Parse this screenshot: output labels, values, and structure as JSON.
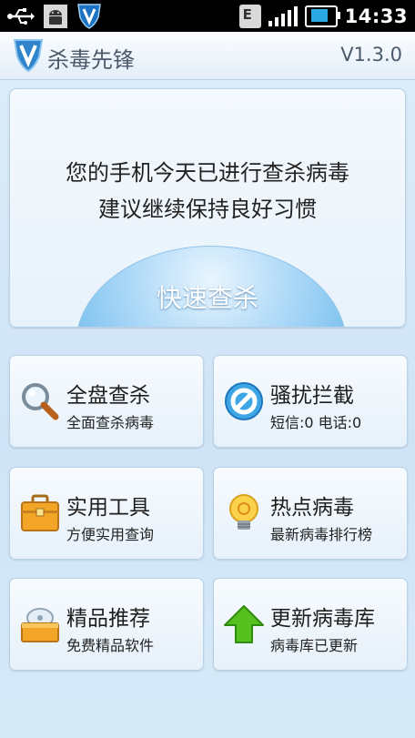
{
  "status_bar": {
    "time": "14:33",
    "network_type": "E",
    "icons": [
      "usb-icon",
      "android-debug-icon",
      "app-shield-icon",
      "network-e-icon",
      "signal-icon",
      "battery-charging-icon"
    ]
  },
  "header": {
    "app_title": "杀毒先锋",
    "version": "V1.3.0"
  },
  "scan": {
    "message_line1": "您的手机今天已进行查杀病毒",
    "message_line2": "建议继续保持良好习惯",
    "button_label": "快速查杀"
  },
  "tiles": [
    {
      "title": "全盘查杀",
      "subtitle": "全面查杀病毒",
      "icon": "magnifier-icon"
    },
    {
      "title": "骚扰拦截",
      "subtitle": "短信:0 电话:0",
      "icon": "block-icon"
    },
    {
      "title": "实用工具",
      "subtitle": "方便实用查询",
      "icon": "toolbox-icon"
    },
    {
      "title": "热点病毒",
      "subtitle": "最新病毒排行榜",
      "icon": "lightbulb-icon"
    },
    {
      "title": "精品推荐",
      "subtitle": "免费精品软件",
      "icon": "software-box-icon"
    },
    {
      "title": "更新病毒库",
      "subtitle": "病毒库已更新",
      "icon": "update-arrow-icon"
    }
  ],
  "colors": {
    "accent_blue": "#5fb3ea",
    "update_green": "#4cbb17",
    "background": "#dfeefa"
  }
}
